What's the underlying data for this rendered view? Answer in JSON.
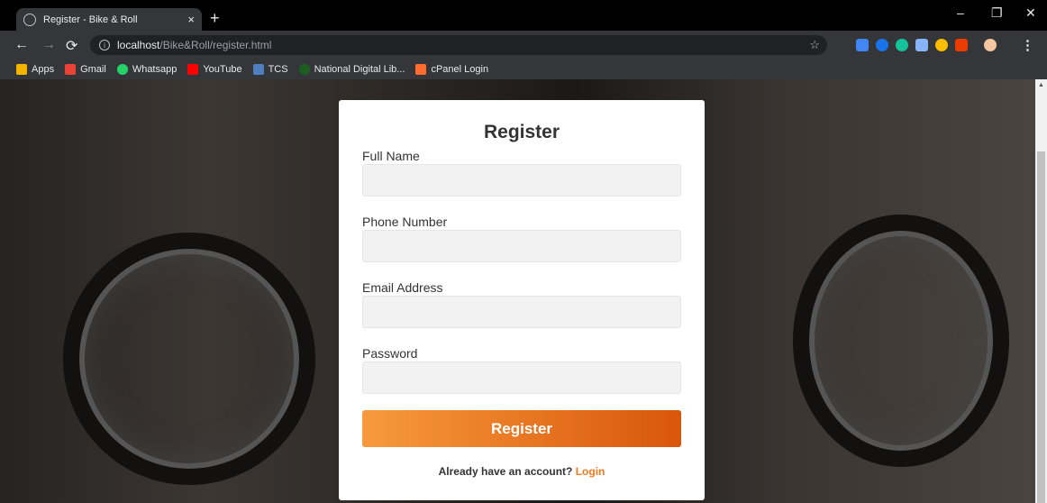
{
  "browser": {
    "tab_title": "Register - Bike & Roll",
    "tab_close": "×",
    "new_tab": "+",
    "url_host": "localhost",
    "url_path": "/Bike&Roll/register.html",
    "window_controls": [
      "–",
      "❐",
      "✕"
    ],
    "bookmarks": [
      {
        "label": "Apps",
        "color": "#f4b400"
      },
      {
        "label": "Gmail",
        "color": "#ea4335"
      },
      {
        "label": "Whatsapp",
        "color": "#25d366"
      },
      {
        "label": "YouTube",
        "color": "#ff0000"
      },
      {
        "label": "TCS",
        "color": "#4f7fbf"
      },
      {
        "label": "National Digital Lib...",
        "color": "#1b5e20"
      },
      {
        "label": "cPanel Login",
        "color": "#ff6c2c"
      }
    ]
  },
  "form": {
    "title": "Register",
    "fields": [
      {
        "label": "Full Name",
        "value": ""
      },
      {
        "label": "Phone Number",
        "value": ""
      },
      {
        "label": "Email Address",
        "value": ""
      },
      {
        "label": "Password",
        "value": ""
      }
    ],
    "submit_label": "Register",
    "footer_text": "Already have an account?",
    "footer_link": "Login"
  }
}
